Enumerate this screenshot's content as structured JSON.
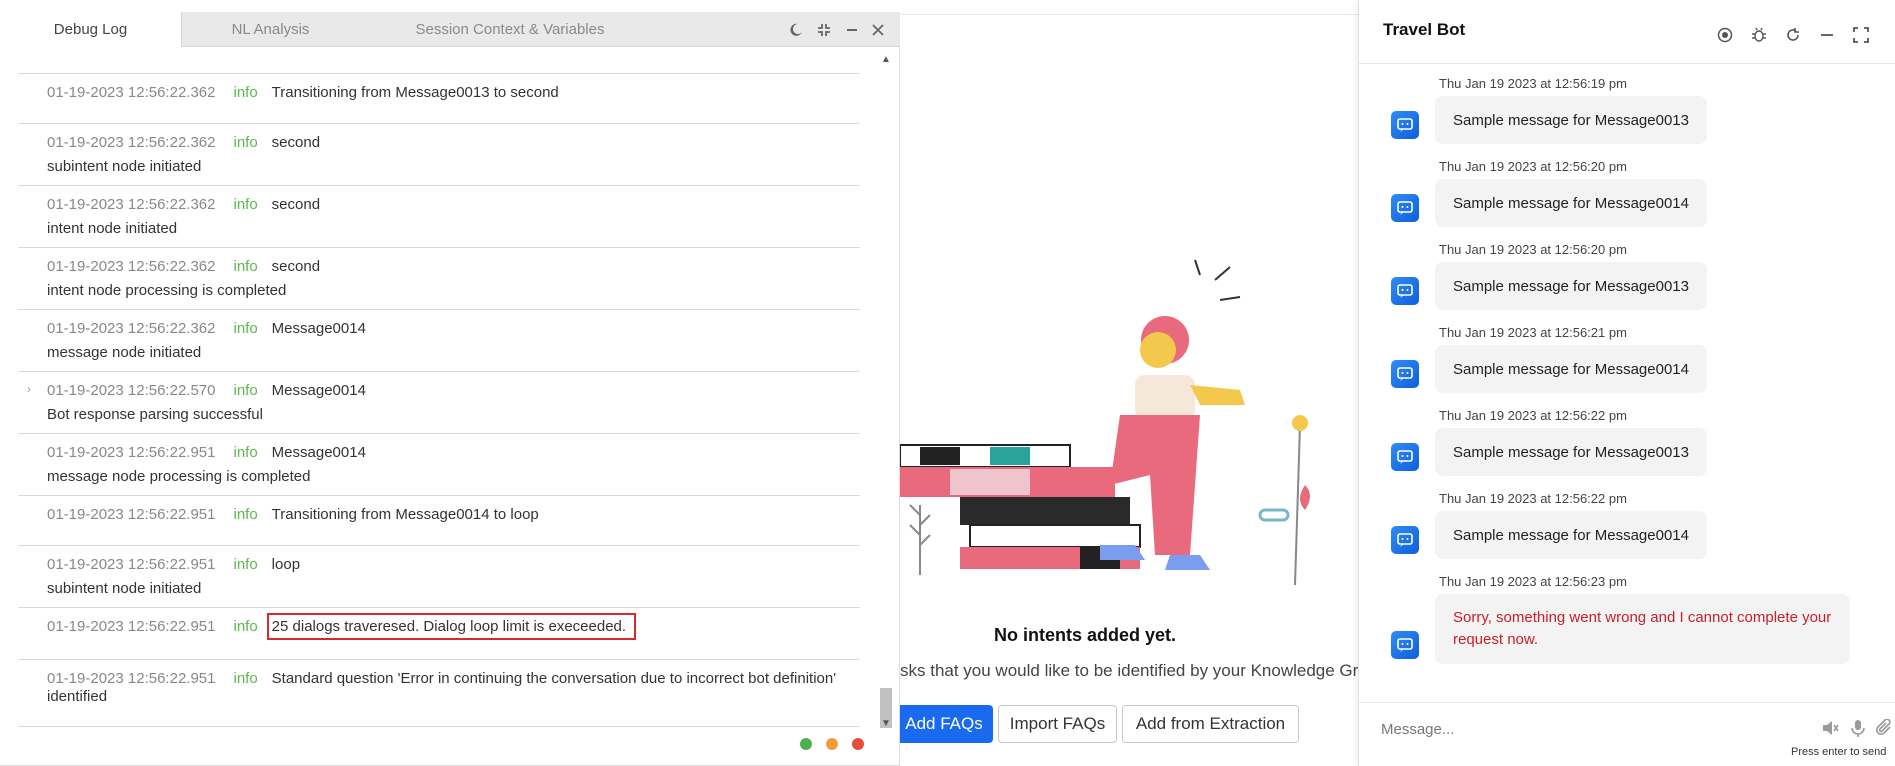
{
  "background": {
    "empty_title": "No intents added yet.",
    "empty_desc": "sks that you would like to be identified by your Knowledge Gr",
    "add_faqs": "Add FAQs",
    "import_faqs": "Import FAQs",
    "add_from_extraction": "Add from Extraction"
  },
  "debug": {
    "tabs": [
      "Debug Log",
      "NL Analysis",
      "Session Context & Variables"
    ],
    "rows": [
      {
        "ts": "01-19-2023 12:56:22.362",
        "level": "info",
        "msg": "Transitioning from Message0013 to second",
        "sub": ""
      },
      {
        "ts": "01-19-2023 12:56:22.362",
        "level": "info",
        "msg": "second",
        "sub": "subintent node initiated"
      },
      {
        "ts": "01-19-2023 12:56:22.362",
        "level": "info",
        "msg": "second",
        "sub": "intent node initiated"
      },
      {
        "ts": "01-19-2023 12:56:22.362",
        "level": "info",
        "msg": "second",
        "sub": "intent node processing is completed"
      },
      {
        "ts": "01-19-2023 12:56:22.362",
        "level": "info",
        "msg": "Message0014",
        "sub": "message node initiated"
      },
      {
        "ts": "01-19-2023 12:56:22.570",
        "level": "info",
        "msg": "Message0014",
        "sub": "Bot response parsing successful"
      },
      {
        "ts": "01-19-2023 12:56:22.951",
        "level": "info",
        "msg": "Message0014",
        "sub": "message node processing is completed"
      },
      {
        "ts": "01-19-2023 12:56:22.951",
        "level": "info",
        "msg": "Transitioning from Message0014 to loop",
        "sub": ""
      },
      {
        "ts": "01-19-2023 12:56:22.951",
        "level": "info",
        "msg": "loop",
        "sub": "subintent node initiated"
      },
      {
        "ts": "01-19-2023 12:56:22.951",
        "level": "info",
        "msg": "25 dialogs traveresed. Dialog loop limit is execeeded.",
        "sub": ""
      },
      {
        "ts": "01-19-2023 12:56:22.951",
        "level": "info",
        "msg": "Standard question 'Error in continuing the conversation due to incorrect bot definition'",
        "sub": "identified"
      }
    ],
    "status_colors": [
      "#4caf50",
      "#f39c3c",
      "#e74c3c"
    ]
  },
  "chat": {
    "title": "Travel Bot",
    "messages": [
      {
        "ts": "Thu Jan 19 2023 at 12:56:19 pm",
        "text": "Sample message for Message0013"
      },
      {
        "ts": "Thu Jan 19 2023 at 12:56:20 pm",
        "text": "Sample message for Message0014"
      },
      {
        "ts": "Thu Jan 19 2023 at 12:56:20 pm",
        "text": "Sample message for Message0013"
      },
      {
        "ts": "Thu Jan 19 2023 at 12:56:21 pm",
        "text": "Sample message for Message0014"
      },
      {
        "ts": "Thu Jan 19 2023 at 12:56:22 pm",
        "text": "Sample message for Message0013"
      },
      {
        "ts": "Thu Jan 19 2023 at 12:56:22 pm",
        "text": "Sample message for Message0014"
      },
      {
        "ts": "Thu Jan 19 2023 at 12:56:23 pm",
        "text": "Sorry, something went wrong and I cannot complete your request now."
      }
    ],
    "input_placeholder": "Message...",
    "hint": "Press enter to send"
  }
}
